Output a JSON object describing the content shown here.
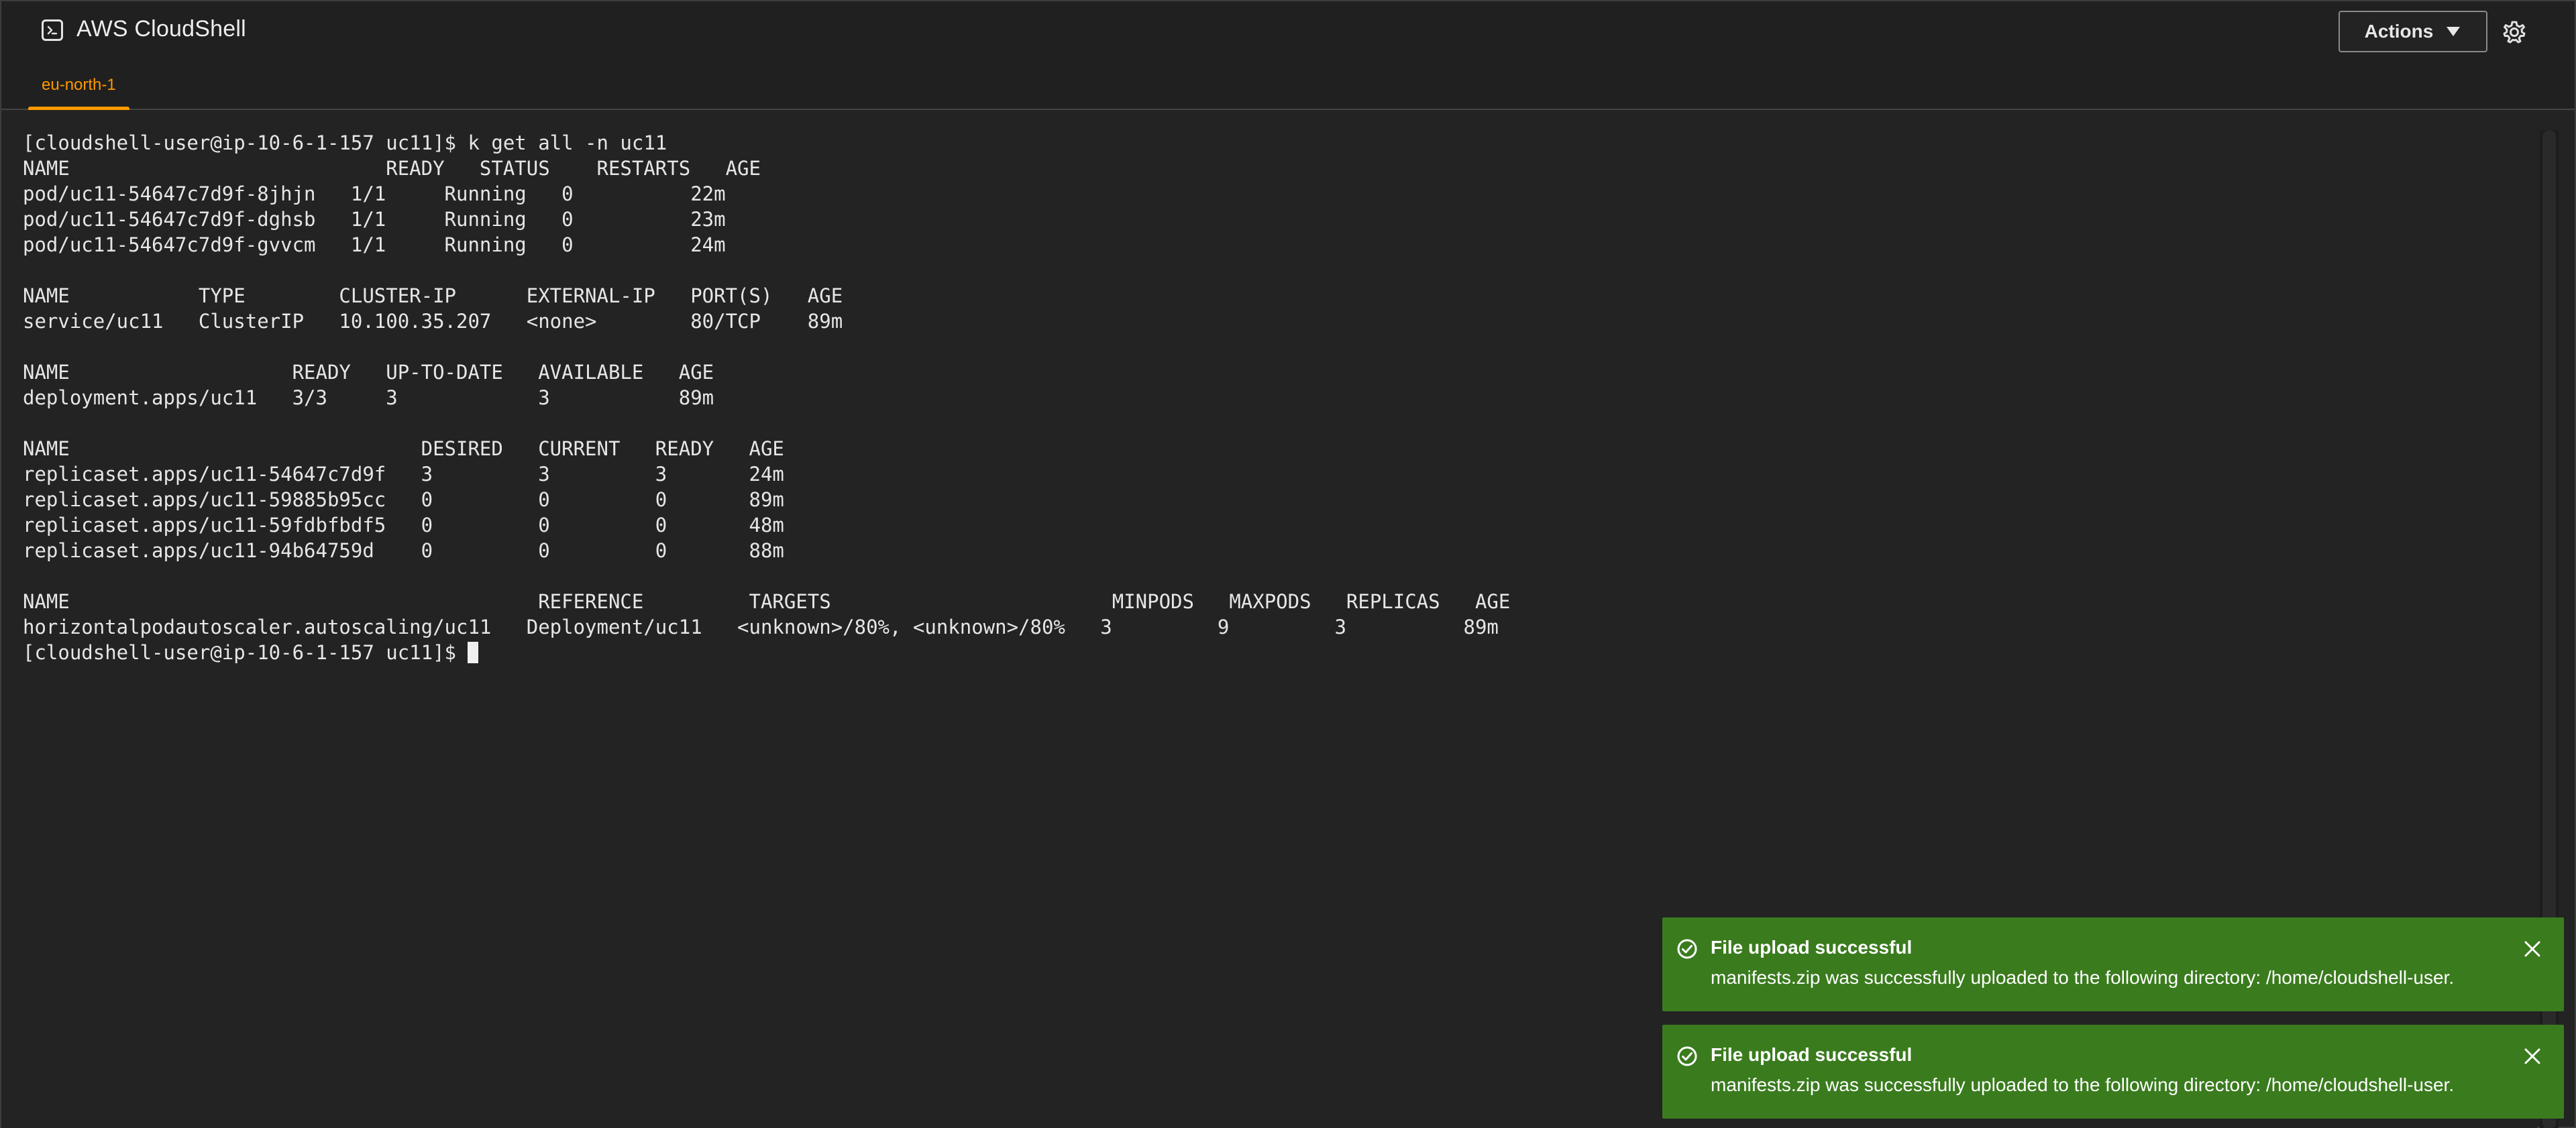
{
  "header": {
    "title": "AWS CloudShell",
    "app_icon": "terminal-icon",
    "actions_label": "Actions",
    "settings_icon": "gear-icon"
  },
  "tabs": [
    {
      "label": "eu-north-1",
      "active": true
    }
  ],
  "terminal": {
    "lines": [
      "[cloudshell-user@ip-10-6-1-157 uc11]$ k get all -n uc11",
      "NAME                           READY   STATUS    RESTARTS   AGE",
      "pod/uc11-54647c7d9f-8jhjn   1/1     Running   0          22m",
      "pod/uc11-54647c7d9f-dghsb   1/1     Running   0          23m",
      "pod/uc11-54647c7d9f-gvvcm   1/1     Running   0          24m",
      "",
      "NAME           TYPE        CLUSTER-IP      EXTERNAL-IP   PORT(S)   AGE",
      "service/uc11   ClusterIP   10.100.35.207   <none>        80/TCP    89m",
      "",
      "NAME                   READY   UP-TO-DATE   AVAILABLE   AGE",
      "deployment.apps/uc11   3/3     3            3           89m",
      "",
      "NAME                              DESIRED   CURRENT   READY   AGE",
      "replicaset.apps/uc11-54647c7d9f   3         3         3       24m",
      "replicaset.apps/uc11-59885b95cc   0         0         0       89m",
      "replicaset.apps/uc11-59fdbfbdf5   0         0         0       48m",
      "replicaset.apps/uc11-94b64759d    0         0         0       88m",
      "",
      "NAME                                        REFERENCE         TARGETS                        MINPODS   MAXPODS   REPLICAS   AGE",
      "horizontalpodautoscaler.autoscaling/uc11   Deployment/uc11   <unknown>/80%, <unknown>/80%   3         9         3          89m"
    ],
    "prompt": "[cloudshell-user@ip-10-6-1-157 uc11]$ "
  },
  "notifications": [
    {
      "title": "File upload successful",
      "message": "manifests.zip was successfully uploaded to the following directory: /home/cloudshell-user.",
      "color": "#3a7b1e",
      "icon": "check-circle-icon"
    },
    {
      "title": "File upload successful",
      "message": "manifests.zip was successfully uploaded to the following directory: /home/cloudshell-user.",
      "color": "#3a7b1e",
      "icon": "check-circle-icon"
    }
  ],
  "colors": {
    "accent": "#ff9900",
    "background": "#232323",
    "success": "#3a7b1e"
  }
}
